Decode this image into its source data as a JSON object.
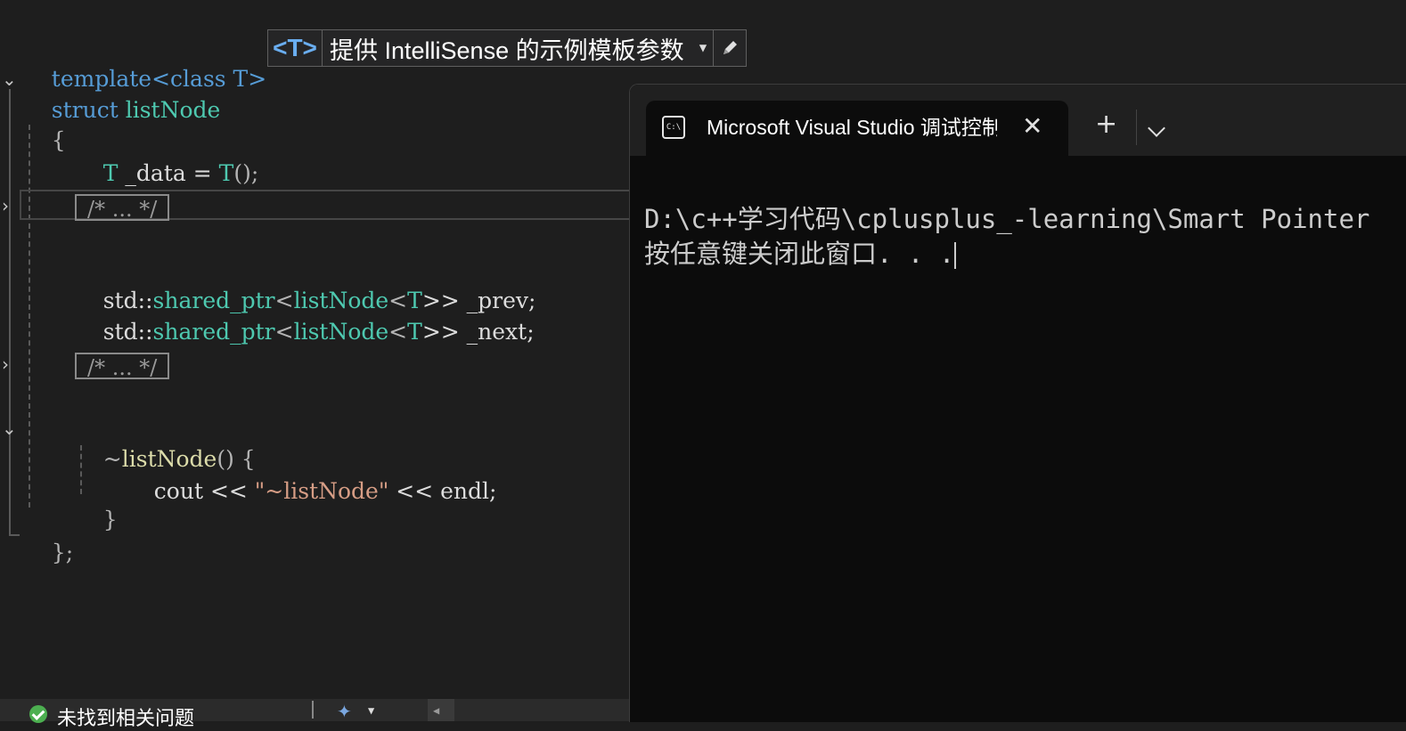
{
  "editor": {
    "lines": {
      "l1_kw": "template",
      "l1_rest": "<class T>",
      "l2_kw": "struct",
      "l2_name": "listNode",
      "l3": "{",
      "l4_type": "T",
      "l4_mid": " _data = ",
      "l4_call": "T",
      "l4_end": "();",
      "collapsed_1": "/* ... */",
      "l6_ns": "std::",
      "l6_type": "shared_ptr",
      "l6_t1": "<",
      "l6_t2": "listNode",
      "l6_t3": "<",
      "l6_t4": "T",
      "l6_t5": ">> _prev;",
      "l7_ns": "std::",
      "l7_type": "shared_ptr",
      "l7_t1": "<",
      "l7_t2": "listNode",
      "l7_t3": "<",
      "l7_t4": "T",
      "l7_t5": ">> _next;",
      "collapsed_2": "/* ... */",
      "l9_tilde": "~",
      "l9_fn": "listNode",
      "l9_rest": "() {",
      "l10_a": "cout << ",
      "l10_str": "\"~listNode\"",
      "l10_b": " << endl;",
      "l11": "}",
      "l12": "};"
    }
  },
  "intellisense_hint": {
    "param": "<T>",
    "text": "提供 IntelliSense 的示例模板参数",
    "dropdown_icon": "caret-down-icon",
    "edit_icon": "pencil-icon"
  },
  "status_bar": {
    "issues_text": "未找到相关问题",
    "status_icon": "check-circle-icon",
    "brush_icon": "code-cleanup-icon"
  },
  "terminal": {
    "tab_title": "Microsoft Visual Studio 调试控制台",
    "icon": "console-icon",
    "icon_text": "C:\\",
    "new_tab_label": "+",
    "output_line1": "D:\\c++学习代码\\cplusplus_-learning\\Smart Pointer",
    "output_line2": "按任意键关闭此窗口. . ."
  },
  "colors": {
    "editor_bg": "#1e1e1e",
    "keyword": "#569cd6",
    "type": "#4ec9b0",
    "function": "#dcdcaa",
    "string": "#d69d85",
    "terminal_bg": "#0c0c0c"
  }
}
